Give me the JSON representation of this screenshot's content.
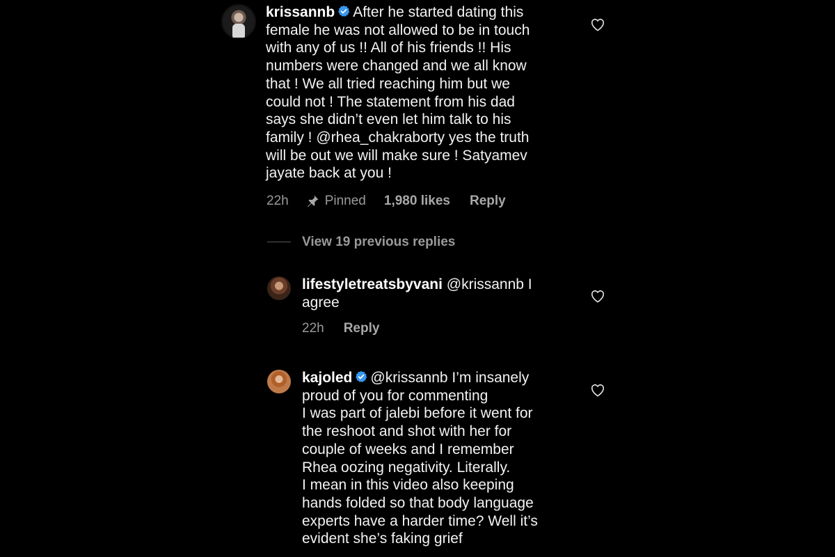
{
  "colors": {
    "background": "#000000",
    "text": "#f3f3f3",
    "muted": "#9a9a9a",
    "verified": "#3897f0"
  },
  "main_comment": {
    "username": "krissannb",
    "verified": true,
    "text": "After he started dating this\nfemale he was not allowed to be in touch\nwith any of us !! All of his friends !! His\nnumbers were changed and we all know\nthat ! We all tried reaching him but we\ncould not ! The statement from his dad\nsays she didn’t even let him talk to his\nfamily ! @rhea_chakraborty yes the truth\nwill be out we will make sure ! Satyamev\njayate back at you !",
    "time": "22h",
    "pinned_label": "Pinned",
    "likes": "1,980 likes",
    "reply_label": "Reply"
  },
  "view_replies_label": "View 19 previous replies",
  "replies": [
    {
      "username": "lifestyletreatsbyvani",
      "verified": false,
      "text": "@krissannb I\nagree",
      "time": "22h",
      "reply_label": "Reply"
    },
    {
      "username": "kajoled",
      "verified": true,
      "text": "@krissannb I’m insanely\nproud of you for commenting\nI was part of jalebi before it went for\nthe reshoot and shot with her for\ncouple of weeks and I remember\nRhea oozing negativity. Literally.\nI mean in this video also keeping\nhands folded so that body language\nexperts have a harder time? Well it’s\nevident she’s faking grief"
    }
  ],
  "icons": {
    "like": "heart-outline-icon",
    "pin": "pin-icon",
    "verified": "verified-badge-icon"
  }
}
